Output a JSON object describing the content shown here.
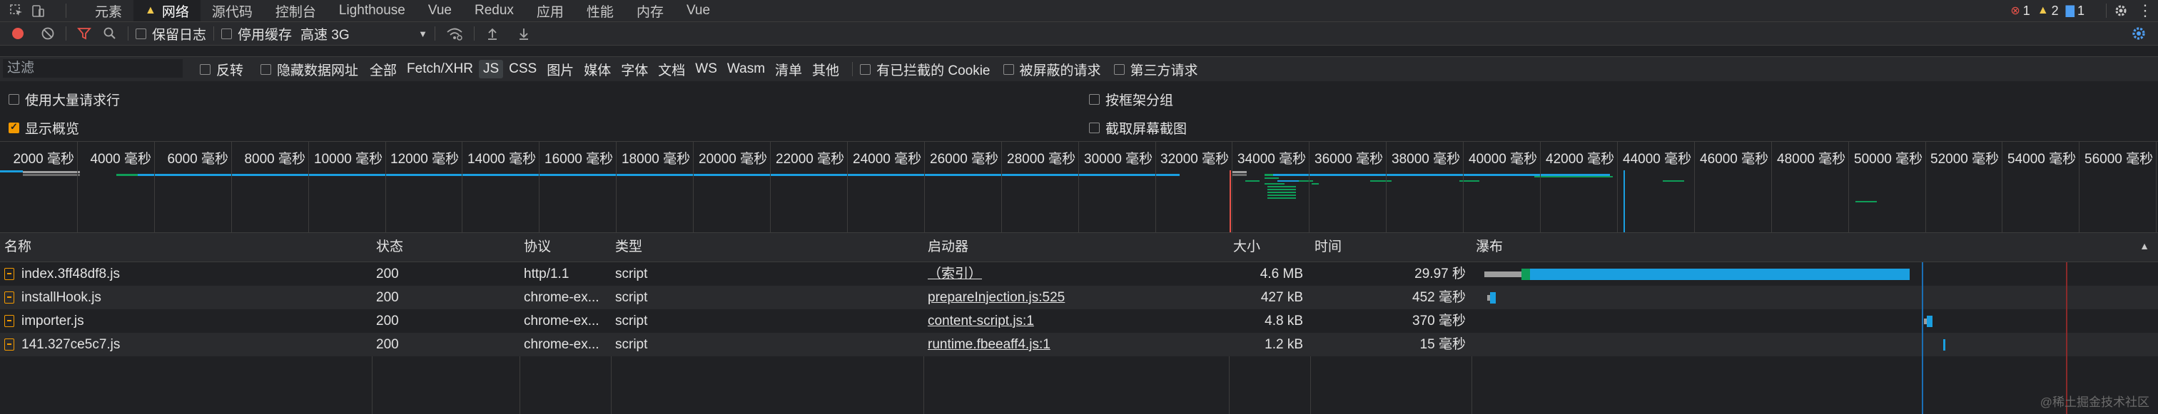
{
  "tabs": {
    "items": [
      {
        "label": "元素"
      },
      {
        "label": "网络",
        "active": true
      },
      {
        "label": "源代码"
      },
      {
        "label": "控制台"
      },
      {
        "label": "Lighthouse"
      },
      {
        "label": "Vue"
      },
      {
        "label": "Redux"
      },
      {
        "label": "应用"
      },
      {
        "label": "性能"
      },
      {
        "label": "内存"
      },
      {
        "label": "Vue"
      }
    ],
    "errors": "1",
    "warnings": "2",
    "messages": "1"
  },
  "toolbar": {
    "preserve_log": "保留日志",
    "disable_cache": "停用缓存",
    "throttling": "高速 3G"
  },
  "filter": {
    "placeholder": "过滤",
    "invert": "反转",
    "hide_data_urls": "隐藏数据网址",
    "types": [
      "全部",
      "Fetch/XHR",
      "JS",
      "CSS",
      "图片",
      "媒体",
      "字体",
      "文档",
      "WS",
      "Wasm",
      "清单",
      "其他"
    ],
    "selected_type": "JS",
    "blocked_cookies": "有已拦截的 Cookie",
    "blocked_requests": "被屏蔽的请求",
    "third_party": "第三方请求"
  },
  "settings": {
    "big_rows": "使用大量请求行",
    "show_overview": "显示概览",
    "group_by_frame": "按框架分组",
    "capture_screenshots": "截取屏幕截图"
  },
  "overview": {
    "ticks": [
      "2000 毫秒",
      "4000 毫秒",
      "6000 毫秒",
      "8000 毫秒",
      "10000 毫秒",
      "12000 毫秒",
      "14000 毫秒",
      "16000 毫秒",
      "18000 毫秒",
      "20000 毫秒",
      "22000 毫秒",
      "24000 毫秒",
      "26000 毫秒",
      "28000 毫秒",
      "30000 毫秒",
      "32000 毫秒",
      "34000 毫秒",
      "36000 毫秒",
      "38000 毫秒",
      "40000 毫秒",
      "42000 毫秒",
      "44000 毫秒",
      "46000 毫秒",
      "48000 毫秒",
      "50000 毫秒",
      "52000 毫秒",
      "54000 毫秒",
      "56000 毫秒"
    ]
  },
  "table": {
    "headers": {
      "name": "名称",
      "status": "状态",
      "protocol": "协议",
      "type": "类型",
      "initiator": "启动器",
      "size": "大小",
      "time": "时间",
      "waterfall": "瀑布"
    },
    "rows": [
      {
        "name": "index.3ff48df8.js",
        "status": "200",
        "protocol": "http/1.1",
        "type": "script",
        "initiator": "（索引）",
        "size": "4.6 MB",
        "time": "29.97 秒"
      },
      {
        "name": "installHook.js",
        "status": "200",
        "protocol": "chrome-ex...",
        "type": "script",
        "initiator": "prepareInjection.js:525",
        "size": "427 kB",
        "time": "452 毫秒"
      },
      {
        "name": "importer.js",
        "status": "200",
        "protocol": "chrome-ex...",
        "type": "script",
        "initiator": "content-script.js:1",
        "size": "4.8 kB",
        "time": "370 毫秒"
      },
      {
        "name": "141.327ce5c7.js",
        "status": "200",
        "protocol": "chrome-ex...",
        "type": "script",
        "initiator": "runtime.fbeeaff4.js:1",
        "size": "1.2 kB",
        "time": "15 毫秒"
      }
    ]
  },
  "watermark": "@稀土掘金技术社区",
  "colors": {
    "accent": "#f29900",
    "blue": "#1a9fe0",
    "green": "#0f9d58",
    "error": "#e8534a"
  }
}
